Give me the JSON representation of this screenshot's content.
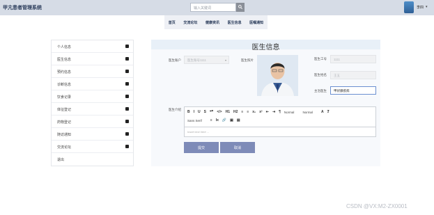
{
  "app": {
    "title": "甲亢患者管理系统"
  },
  "header": {
    "search_placeholder": "输入关键词",
    "username": "李四",
    "caret": "▾"
  },
  "nav": {
    "items": [
      {
        "label": "首页"
      },
      {
        "label": "交流论坛"
      },
      {
        "label": "健康资讯"
      },
      {
        "label": "医生信息"
      },
      {
        "label": "医嘱通知"
      }
    ]
  },
  "sidebar": {
    "items": [
      {
        "label": "个人信息"
      },
      {
        "label": "医生信息"
      },
      {
        "label": "预约信息"
      },
      {
        "label": "诊断信息"
      },
      {
        "label": "饮食记录"
      },
      {
        "label": "体征登记"
      },
      {
        "label": "药物登记"
      },
      {
        "label": "随访通知"
      },
      {
        "label": "交流论坛"
      },
      {
        "label": "退出"
      }
    ]
  },
  "form": {
    "title": "医生信息",
    "doctor_account_label": "医生账户",
    "doctor_account_value": "医生账号1111",
    "doctor_photo_label": "医生照片",
    "doctor_id_label": "医生工号",
    "doctor_id_value": "1111",
    "doctor_name_label": "医生姓名",
    "doctor_name_value": "王五",
    "specialty_label": "主治医生",
    "specialty_value": "甲状腺疾病",
    "intro_label": "医生介绍",
    "toolbar": {
      "row1": [
        "B",
        "I",
        "U",
        "S",
        "❝❞",
        "</>",
        "H1",
        "H2",
        "≡",
        "≡",
        "x₂",
        "x²",
        "⇤",
        "⇥",
        "¶"
      ],
      "heading_select": "Normal",
      "size_select": "Normal",
      "row1_tail": [
        "A",
        "Ⱦ"
      ],
      "font_select": "Sans Serif",
      "row2": [
        "≡",
        "Ix",
        "🔗",
        "▣",
        "▤"
      ]
    },
    "editor_placeholder": "Insert text here ...",
    "submit_label": "提交",
    "cancel_label": "取消"
  },
  "watermark": "CSDN @VX:M2-ZX0001"
}
